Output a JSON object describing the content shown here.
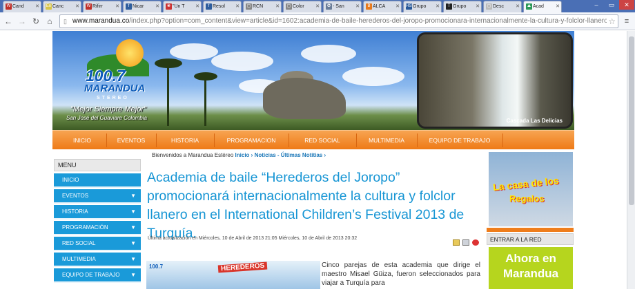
{
  "browser": {
    "tabs": [
      {
        "label": "Cand",
        "fav": "#c0302a",
        "glyph": "W"
      },
      {
        "label": "Canc",
        "fav": "#d8c54a",
        "glyph": "En"
      },
      {
        "label": "Rifirr",
        "fav": "#c0302a",
        "glyph": "W"
      },
      {
        "label": "Nicar",
        "fav": "#2f5e9e",
        "glyph": "f"
      },
      {
        "label": "\"Un T",
        "fav": "#cc3333",
        "glyph": "❀"
      },
      {
        "label": "Resol",
        "fav": "#2f5e9e",
        "glyph": "f"
      },
      {
        "label": "RCN",
        "fav": "#888",
        "glyph": "▢"
      },
      {
        "label": "Color",
        "fav": "#888",
        "glyph": "▢"
      },
      {
        "label": "- San",
        "fav": "#6a7d99",
        "glyph": "✪"
      },
      {
        "label": "ALCA",
        "fav": "#e87a1d",
        "glyph": "B"
      },
      {
        "label": "Grupo",
        "fav": "#2a5a9a",
        "glyph": "HSB"
      },
      {
        "label": "Grupo",
        "fav": "#222",
        "glyph": "T"
      },
      {
        "label": "Desc",
        "fav": "#bbb",
        "glyph": "▢"
      },
      {
        "label": "Acad",
        "fav": "#2e9a5a",
        "glyph": "⛰"
      }
    ],
    "url_domain": "www.marandua.co",
    "url_path": "/index.php?option=com_content&view=article&id=1602:academia-de-baile-herederos-del-joropo-promocionara-internacionalmente-la-cultura-y-folclor-llanero"
  },
  "banner": {
    "logo_number": "100.7",
    "logo_name": "MARANDUA",
    "logo_sub": "STEREO",
    "slogan": "\"Mejor Siempre Mejor\"",
    "location": "San José del Guaviare Colombia",
    "photo_caption": "Cascada Las Delicias"
  },
  "topnav": [
    "INICIO",
    "EVENTOS",
    "HISTORIA",
    "PROGRAMACION",
    "RED SOCIAL",
    "MULTIMEDIA",
    "EQUIPO DE TRABAJO"
  ],
  "sidebar": {
    "title": "MENU",
    "items": [
      {
        "label": "INICIO",
        "caret": ""
      },
      {
        "label": "EVENTOS",
        "caret": "▼"
      },
      {
        "label": "HISTORIA",
        "caret": "▼"
      },
      {
        "label": "PROGRAMACIÓN",
        "caret": "▼"
      },
      {
        "label": "RED SOCIAL",
        "caret": "▼"
      },
      {
        "label": "MULTIMEDIA",
        "caret": "▼"
      },
      {
        "label": "EQUIPO DE TRABAJO",
        "caret": "▼"
      }
    ]
  },
  "article": {
    "breadcrumb_prefix": "Bienvenidos a Marandua Estéreo",
    "breadcrumb_home": "Inicio",
    "breadcrumb_sep1": "›",
    "breadcrumb_section": "Noticias - Últimas Notitias",
    "breadcrumb_sep2": "›",
    "title": "Academia de baile “Herederos del Joropo” promocionará internacionalmente la cultura y folclor llanero en el International Children’s Festival 2013 de Turquía.",
    "meta": "Última actualización en Miércoles, 10 de Abril de 2013 21:05   Miércoles, 10 de Abril de 2013 20:32",
    "image_logo": "100.7",
    "image_heading": "HEREDEROS",
    "body": "Cinco parejas de esta academia que dirige el maestro Misael Güiza, fueron seleccionados para viajar a Turquía para"
  },
  "right": {
    "ad1_line1": "La casa de los",
    "ad1_line2": "Regalos",
    "enter_title": "ENTRAR A LA RED",
    "ad2_text": "Ahora en Marandua"
  },
  "colors": {
    "accent_orange": "#ef7d1b",
    "menu_blue": "#1a9ad9",
    "title_blue": "#1695d4"
  }
}
